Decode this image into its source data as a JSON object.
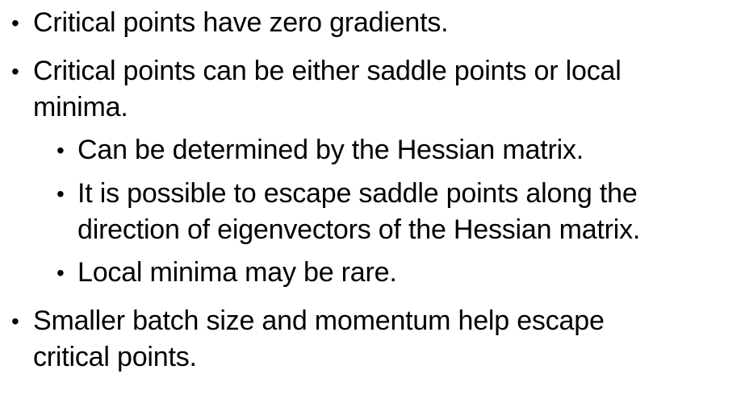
{
  "slide": {
    "bullets": [
      {
        "level": 1,
        "lines": [
          "Critical points have zero gradients."
        ]
      },
      {
        "level": 1,
        "lines": [
          "Critical points can be either saddle points or local",
          "minima."
        ]
      },
      {
        "level": 2,
        "lines": [
          "Can be determined by the Hessian matrix."
        ]
      },
      {
        "level": 2,
        "lines": [
          "It is possible to escape saddle points along the",
          "direction of eigenvectors of the Hessian matrix."
        ]
      },
      {
        "level": 2,
        "lines": [
          "Local minima may be rare."
        ]
      },
      {
        "level": 1,
        "lines": [
          "Smaller batch size and momentum help escape",
          "critical points."
        ]
      }
    ],
    "bullet_glyph": "•"
  }
}
